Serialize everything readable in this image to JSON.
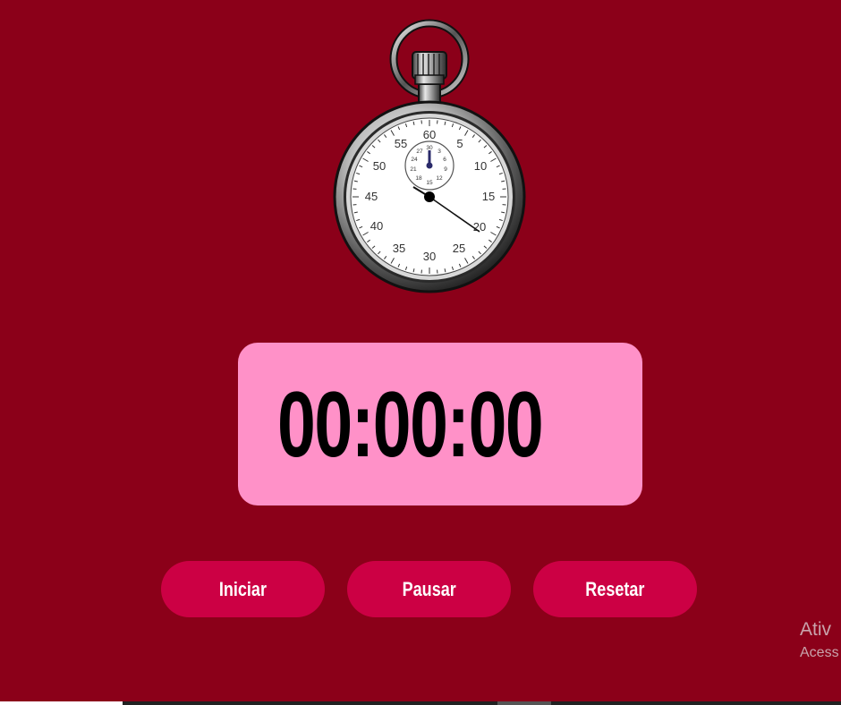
{
  "timer": {
    "display": "00:00:00"
  },
  "buttons": {
    "start_label": "Iniciar",
    "pause_label": "Pausar",
    "reset_label": "Resetar"
  },
  "stopwatch": {
    "icon": "stopwatch-icon",
    "dial_numbers": [
      "60",
      "5",
      "10",
      "15",
      "20",
      "25",
      "30",
      "35",
      "40",
      "45",
      "50",
      "55"
    ],
    "subdial_numbers": [
      "30",
      "3",
      "6",
      "9",
      "12",
      "15",
      "18",
      "21",
      "24",
      "27"
    ]
  },
  "watermark": {
    "title": "Ativ",
    "subtitle": "Acess"
  },
  "colors": {
    "background": "#8b0019",
    "timer_box": "#ff91c8",
    "button": "#cc0044",
    "button_text": "#ffffff",
    "timer_text": "#000000"
  }
}
